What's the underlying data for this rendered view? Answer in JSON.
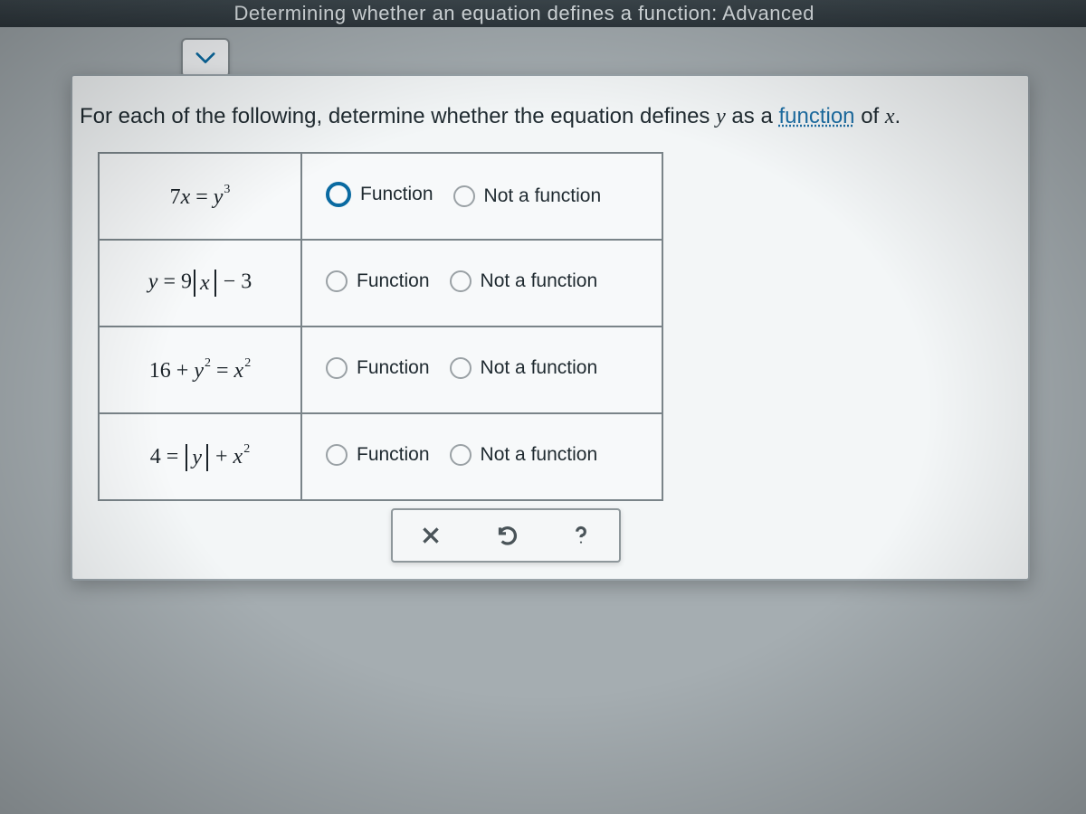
{
  "header": {
    "title_fragment": "Determining whether an equation defines a function: Advanced"
  },
  "prompt": {
    "lead": "For each of the following, determine whether the equation defines ",
    "var_y": "y",
    "mid": " as a ",
    "link_text": "function",
    "tail": " of ",
    "var_x": "x",
    "period": "."
  },
  "labels": {
    "function": "Function",
    "not_function": "Not a function"
  },
  "rows": [
    {
      "eq_html": "7<span class='ital'>x</span> = <span class='ital'>y</span><sup class='expo'>3</sup>",
      "selected": "function"
    },
    {
      "eq_html": "<span class='ital'>y</span> = 9<span class='abs-bar'><span class='ital'>x</span></span> − 3",
      "selected": null
    },
    {
      "eq_html": "16 + <span class='ital'>y</span><sup class='expo'>2</sup> = <span class='ital'>x</span><sup class='expo'>2</sup>",
      "selected": null
    },
    {
      "eq_html": "4 = <span class='abs-bar'><span class='ital'>y</span></span> + <span class='ital'>x</span><sup class='expo'>2</sup>",
      "selected": null
    }
  ],
  "actions": {
    "clear": "×",
    "reset": "↺",
    "help": "?"
  }
}
